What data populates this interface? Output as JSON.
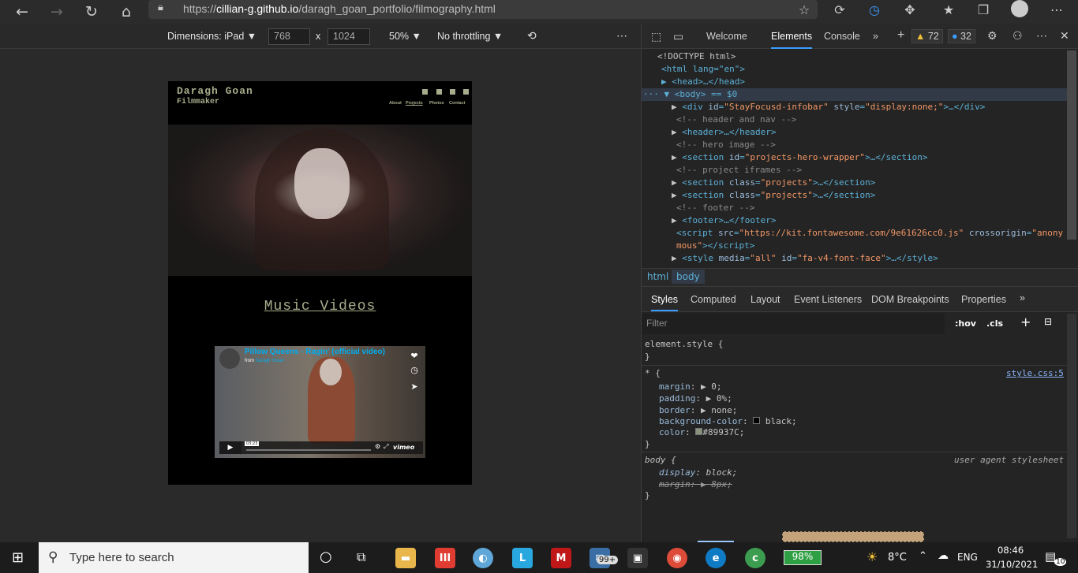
{
  "browser": {
    "url_prefix": "https://",
    "url_domain": "cillian-g.github.io",
    "url_path": "/daragh_goan_portfolio/filmography.html"
  },
  "device_toolbar": {
    "dimensions_label": "Dimensions: iPad",
    "width": "768",
    "times": "x",
    "height": "1024",
    "zoom": "50%",
    "throttling": "No throttling"
  },
  "site": {
    "brand_name": "Daragh Goan",
    "brand_role": "Filmmaker",
    "nav": [
      "About",
      "Projects",
      "Photos",
      "Contact"
    ],
    "section_title": "Music Videos",
    "video": {
      "title": "Pillow Queens - Ragin' (official video)",
      "from_label": "from",
      "author": "Daragh Goan",
      "time": "03:23",
      "logo": "vimeo"
    }
  },
  "devtools": {
    "tabs": [
      "Welcome",
      "Elements",
      "Console"
    ],
    "warnings": "72",
    "issues": "32",
    "dom_lines": [
      "<!DOCTYPE html>",
      "<html lang=\"en\">",
      "<head>…</head>",
      "<body> == $0"
    ],
    "breadcrumb": [
      "html",
      "body"
    ],
    "style_tabs": [
      "Styles",
      "Computed",
      "Layout",
      "Event Listeners",
      "DOM Breakpoints",
      "Properties"
    ],
    "filter_placeholder": "Filter",
    "hov": ":hov",
    "cls": ".cls",
    "rules": {
      "element_style": "element.style {",
      "close": "}",
      "universal": "* {",
      "style_src": "style.css:5",
      "props": [
        [
          "margin",
          "0"
        ],
        [
          "padding",
          "0%"
        ],
        [
          "border",
          "none"
        ],
        [
          "background-color",
          "black"
        ],
        [
          "color",
          "#89937C"
        ]
      ],
      "body_sel": "body {",
      "ua": "user agent stylesheet",
      "body_props": [
        [
          "display",
          "block"
        ],
        [
          "margin",
          "8px"
        ]
      ]
    }
  },
  "taskbar": {
    "search_placeholder": "Type here to search",
    "badge": "99+",
    "battery": "98%",
    "temp": "8°C",
    "lang": "ENG",
    "time": "08:46",
    "date": "31/10/2021",
    "notif": "10"
  },
  "colors": {
    "accent": "#a7ad8c",
    "vimeo": "#00adef"
  }
}
